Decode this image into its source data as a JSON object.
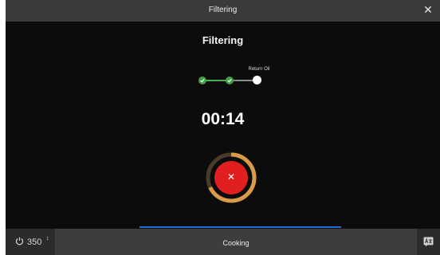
{
  "titlebar": {
    "title": "Filtering",
    "close_glyph": "✕"
  },
  "heading": "Filtering",
  "steps": {
    "current_label": "Return Oil",
    "items": [
      {
        "state": "done",
        "icon": "check-icon"
      },
      {
        "state": "done",
        "icon": "check-icon"
      },
      {
        "state": "current",
        "icon": ""
      }
    ]
  },
  "timer": "00:14",
  "progress": {
    "fraction": 0.68,
    "color": "#d99a4a"
  },
  "stop_button": {
    "glyph": "✕",
    "color": "#e11f1f"
  },
  "bottom_bar": {
    "temperature": "350",
    "unit_symbol": "↕",
    "power_icon": "power-icon",
    "mode_label": "Cooking",
    "corner_icon": "language-icon"
  },
  "colors": {
    "accent_blue": "#1e6fd9",
    "success_green": "#43a047"
  }
}
